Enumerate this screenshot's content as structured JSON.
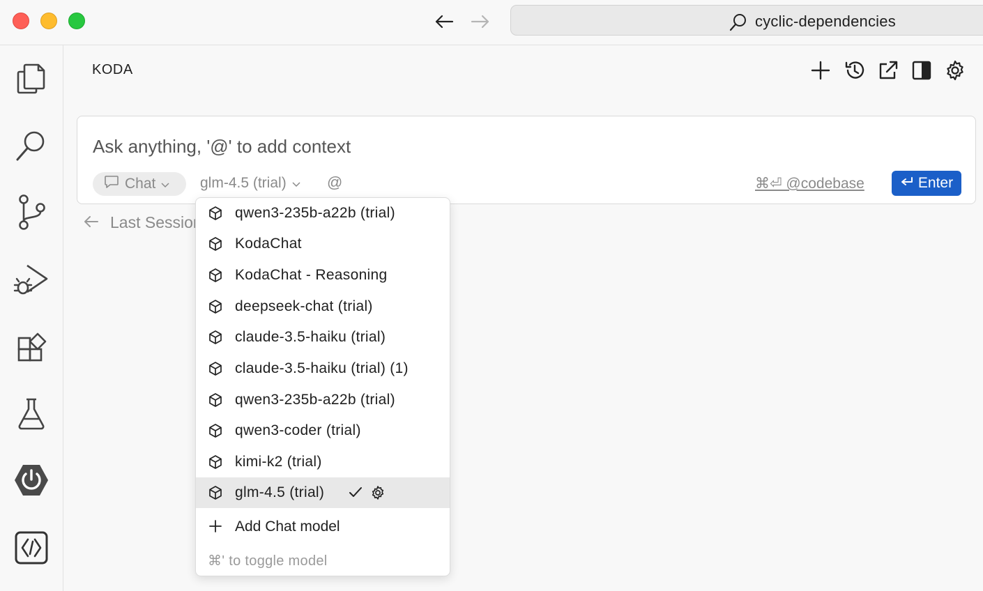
{
  "window": {
    "search_text": "cyclic-dependencies"
  },
  "panel": {
    "title": "KODA"
  },
  "input": {
    "placeholder": "Ask anything, '@' to add context",
    "mode_label": "Chat",
    "model_label": "glm-4.5 (trial)",
    "at_label": "@",
    "codebase_label": "⌘⏎ @codebase",
    "enter_label": "Enter"
  },
  "last_session": {
    "label": "Last Session"
  },
  "model_menu": {
    "items": [
      {
        "label": "qwen3-235b-a22b (trial)"
      },
      {
        "label": "KodaChat"
      },
      {
        "label": "KodaChat - Reasoning"
      },
      {
        "label": "deepseek-chat (trial)"
      },
      {
        "label": "claude-3.5-haiku (trial)"
      },
      {
        "label": "claude-3.5-haiku (trial) (1)"
      },
      {
        "label": "qwen3-235b-a22b (trial)"
      },
      {
        "label": "qwen3-coder (trial)"
      },
      {
        "label": "kimi-k2 (trial)"
      },
      {
        "label": "glm-4.5 (trial)",
        "selected": true
      }
    ],
    "add_label": "Add Chat model",
    "hint": "⌘' to toggle model"
  },
  "colors": {
    "accent": "#1b5fc8",
    "selected_row": "#e8e8e8"
  },
  "icons": {
    "activity_bar": [
      "explorer-icon",
      "search-icon",
      "source-control-icon",
      "run-debug-icon",
      "extensions-icon",
      "testing-icon",
      "spring-boot-icon",
      "remote-icon"
    ],
    "header": [
      "new-chat-icon",
      "history-icon",
      "open-in-editor-icon",
      "toggle-panel-icon",
      "settings-icon"
    ]
  }
}
